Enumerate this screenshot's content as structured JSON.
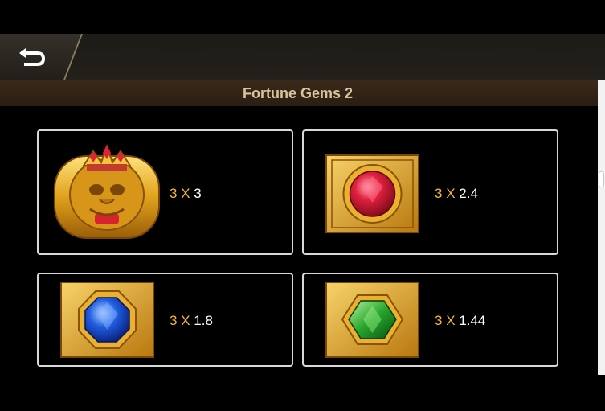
{
  "header": {
    "back_icon": "back-arrow-icon"
  },
  "title": "Fortune Gems 2",
  "colors": {
    "accent": "#f0b72a",
    "title": "#d9c39b",
    "border": "#d8d8d8"
  },
  "paytable": [
    {
      "symbol": "golden-mask-ring",
      "count": "3",
      "x": "X",
      "multiplier": "3"
    },
    {
      "symbol": "red-gem",
      "count": "3",
      "x": "X",
      "multiplier": "2.4"
    },
    {
      "symbol": "blue-gem",
      "count": "3",
      "x": "X",
      "multiplier": "1.8"
    },
    {
      "symbol": "green-gem",
      "count": "3",
      "x": "X",
      "multiplier": "1.44"
    }
  ]
}
